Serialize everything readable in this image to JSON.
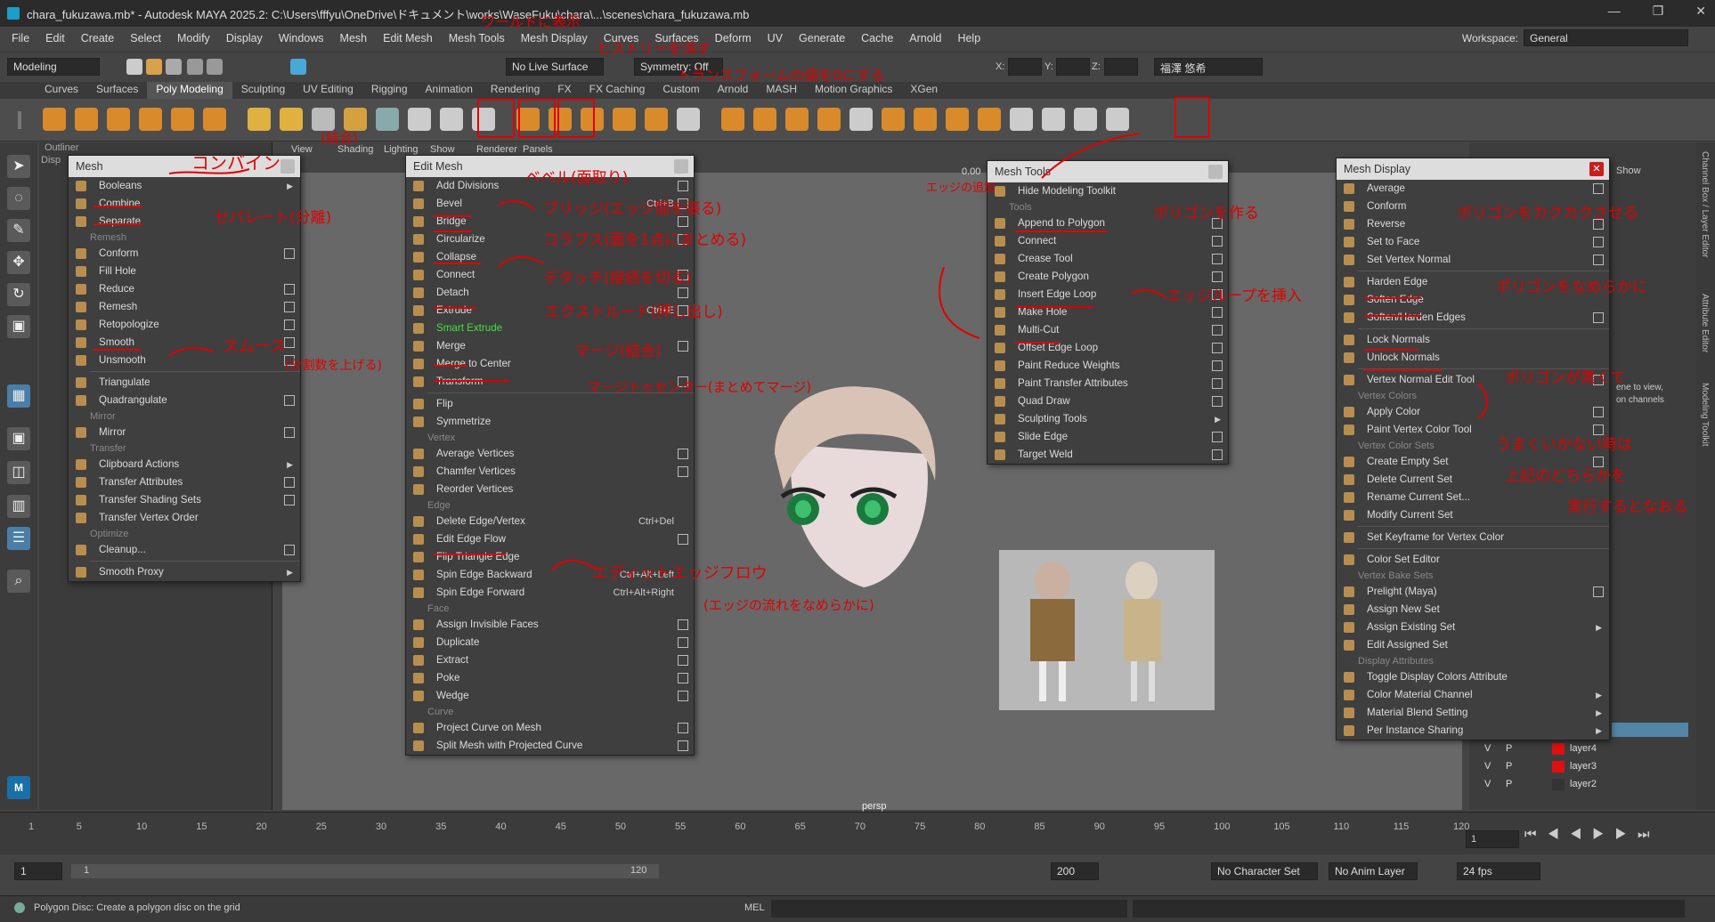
{
  "window": {
    "title": "chara_fukuzawa.mb* - Autodesk MAYA 2025.2: C:\\Users\\fffyu\\OneDrive\\ドキュメント\\works\\WaseFuku\\chara\\...\\scenes\\chara_fukuzawa.mb",
    "controls": [
      "—",
      "❐",
      "✕"
    ]
  },
  "menubar": [
    "File",
    "Edit",
    "Create",
    "Select",
    "Modify",
    "Display",
    "Windows",
    "Mesh",
    "Edit Mesh",
    "Mesh Tools",
    "Mesh Display",
    "Curves",
    "Surfaces",
    "Deform",
    "UV",
    "Generate",
    "Cache",
    "Arnold",
    "Help"
  ],
  "workspace": {
    "label": "Workspace:",
    "value": "General"
  },
  "statusline": {
    "mode": "Modeling",
    "live": "No Live Surface",
    "symmetry": "Symmetry: Off",
    "x": "X:",
    "y": "Y:",
    "z": "Z:",
    "user": "福澤 悠希"
  },
  "shelf_tabs": [
    "Curves",
    "Surfaces",
    "Poly Modeling",
    "Sculpting",
    "UV Editing",
    "Rigging",
    "Animation",
    "Rendering",
    "FX",
    "FX Caching",
    "Custom",
    "Arnold",
    "MASH",
    "Motion Graphics",
    "XGen"
  ],
  "shelf_active": "Poly Modeling",
  "outliner": {
    "title": "Outliner",
    "sub": "Disp"
  },
  "viewport": {
    "menus": [
      "View",
      "Shading",
      "Lighting",
      "Show",
      "Renderer",
      "Panels"
    ],
    "camera": "persp",
    "value": "0.00"
  },
  "menu_mesh": {
    "title": "Mesh",
    "items": [
      {
        "t": "item",
        "label": "Booleans",
        "arrow": true
      },
      {
        "t": "item",
        "label": "Combine"
      },
      {
        "t": "item",
        "label": "Separate"
      },
      {
        "t": "sec",
        "label": "Remesh"
      },
      {
        "t": "item",
        "label": "Conform",
        "opt": true
      },
      {
        "t": "item",
        "label": "Fill Hole"
      },
      {
        "t": "item",
        "label": "Reduce",
        "opt": true
      },
      {
        "t": "item",
        "label": "Remesh",
        "opt": true
      },
      {
        "t": "item",
        "label": "Retopologize",
        "opt": true
      },
      {
        "t": "item",
        "label": "Smooth",
        "opt": true
      },
      {
        "t": "item",
        "label": "Unsmooth",
        "opt": true
      },
      {
        "t": "sep"
      },
      {
        "t": "item",
        "label": "Triangulate"
      },
      {
        "t": "item",
        "label": "Quadrangulate",
        "opt": true
      },
      {
        "t": "sec",
        "label": "Mirror"
      },
      {
        "t": "item",
        "label": "Mirror",
        "opt": true
      },
      {
        "t": "sec",
        "label": "Transfer"
      },
      {
        "t": "item",
        "label": "Clipboard Actions",
        "arrow": true
      },
      {
        "t": "item",
        "label": "Transfer Attributes",
        "opt": true
      },
      {
        "t": "item",
        "label": "Transfer Shading Sets",
        "opt": true
      },
      {
        "t": "item",
        "label": "Transfer Vertex Order"
      },
      {
        "t": "sec",
        "label": "Optimize"
      },
      {
        "t": "item",
        "label": "Cleanup...",
        "opt": true
      },
      {
        "t": "sep"
      },
      {
        "t": "item",
        "label": "Smooth Proxy",
        "arrow": true
      }
    ]
  },
  "menu_editmesh": {
    "title": "Edit Mesh",
    "items": [
      {
        "t": "item",
        "label": "Add Divisions",
        "opt": true
      },
      {
        "t": "item",
        "label": "Bevel",
        "sc": "Ctrl+B",
        "opt": true
      },
      {
        "t": "item",
        "label": "Bridge",
        "opt": true
      },
      {
        "t": "item",
        "label": "Circularize",
        "opt": true
      },
      {
        "t": "item",
        "label": "Collapse"
      },
      {
        "t": "item",
        "label": "Connect",
        "opt": true
      },
      {
        "t": "item",
        "label": "Detach",
        "opt": true
      },
      {
        "t": "item",
        "label": "Extrude",
        "sc": "Ctrl+E",
        "opt": true
      },
      {
        "t": "item",
        "label": "Smart Extrude",
        "green": true
      },
      {
        "t": "item",
        "label": "Merge",
        "opt": true
      },
      {
        "t": "item",
        "label": "Merge to Center"
      },
      {
        "t": "item",
        "label": "Transform",
        "opt": true
      },
      {
        "t": "sep"
      },
      {
        "t": "item",
        "label": "Flip"
      },
      {
        "t": "item",
        "label": "Symmetrize"
      },
      {
        "t": "sec",
        "label": "Vertex"
      },
      {
        "t": "item",
        "label": "Average Vertices",
        "opt": true
      },
      {
        "t": "item",
        "label": "Chamfer Vertices",
        "opt": true
      },
      {
        "t": "item",
        "label": "Reorder Vertices"
      },
      {
        "t": "sec",
        "label": "Edge"
      },
      {
        "t": "item",
        "label": "Delete Edge/Vertex",
        "sc": "Ctrl+Del"
      },
      {
        "t": "item",
        "label": "Edit Edge Flow",
        "opt": true
      },
      {
        "t": "item",
        "label": "Flip Triangle Edge"
      },
      {
        "t": "item",
        "label": "Spin Edge Backward",
        "sc": "Ctrl+Alt+Left"
      },
      {
        "t": "item",
        "label": "Spin Edge Forward",
        "sc": "Ctrl+Alt+Right"
      },
      {
        "t": "sec",
        "label": "Face"
      },
      {
        "t": "item",
        "label": "Assign Invisible Faces",
        "opt": true
      },
      {
        "t": "item",
        "label": "Duplicate",
        "opt": true
      },
      {
        "t": "item",
        "label": "Extract",
        "opt": true
      },
      {
        "t": "item",
        "label": "Poke",
        "opt": true
      },
      {
        "t": "item",
        "label": "Wedge",
        "opt": true
      },
      {
        "t": "sec",
        "label": "Curve"
      },
      {
        "t": "item",
        "label": "Project Curve on Mesh",
        "opt": true
      },
      {
        "t": "item",
        "label": "Split Mesh with Projected Curve",
        "opt": true
      }
    ]
  },
  "menu_meshtools": {
    "title": "Mesh Tools",
    "items": [
      {
        "t": "item",
        "label": "Hide Modeling Toolkit"
      },
      {
        "t": "sec",
        "label": "Tools"
      },
      {
        "t": "item",
        "label": "Append to Polygon",
        "opt": true
      },
      {
        "t": "item",
        "label": "Connect",
        "opt": true
      },
      {
        "t": "item",
        "label": "Crease Tool",
        "opt": true
      },
      {
        "t": "item",
        "label": "Create Polygon",
        "opt": true
      },
      {
        "t": "item",
        "label": "Insert Edge Loop",
        "opt": true
      },
      {
        "t": "item",
        "label": "Make Hole",
        "opt": true
      },
      {
        "t": "item",
        "label": "Multi-Cut",
        "opt": true
      },
      {
        "t": "item",
        "label": "Offset Edge Loop",
        "opt": true
      },
      {
        "t": "item",
        "label": "Paint Reduce Weights",
        "opt": true
      },
      {
        "t": "item",
        "label": "Paint Transfer Attributes",
        "opt": true
      },
      {
        "t": "item",
        "label": "Quad Draw",
        "opt": true
      },
      {
        "t": "item",
        "label": "Sculpting Tools",
        "arrow": true
      },
      {
        "t": "item",
        "label": "Slide Edge",
        "opt": true
      },
      {
        "t": "item",
        "label": "Target Weld",
        "opt": true
      }
    ]
  },
  "menu_meshdisplay": {
    "title": "Mesh Display",
    "items": [
      {
        "t": "item",
        "label": "Average",
        "opt": true
      },
      {
        "t": "item",
        "label": "Conform"
      },
      {
        "t": "item",
        "label": "Reverse",
        "opt": true
      },
      {
        "t": "item",
        "label": "Set to Face",
        "opt": true
      },
      {
        "t": "item",
        "label": "Set Vertex Normal",
        "opt": true
      },
      {
        "t": "sep"
      },
      {
        "t": "item",
        "label": "Harden Edge"
      },
      {
        "t": "item",
        "label": "Soften Edge"
      },
      {
        "t": "item",
        "label": "Soften/Harden Edges",
        "opt": true
      },
      {
        "t": "sep"
      },
      {
        "t": "item",
        "label": "Lock Normals"
      },
      {
        "t": "item",
        "label": "Unlock Normals"
      },
      {
        "t": "sep"
      },
      {
        "t": "item",
        "label": "Vertex Normal Edit Tool",
        "opt": true
      },
      {
        "t": "sec",
        "label": "Vertex Colors"
      },
      {
        "t": "item",
        "label": "Apply Color",
        "opt": true
      },
      {
        "t": "item",
        "label": "Paint Vertex Color Tool",
        "opt": true
      },
      {
        "t": "sec",
        "label": "Vertex Color Sets"
      },
      {
        "t": "item",
        "label": "Create Empty Set",
        "opt": true
      },
      {
        "t": "item",
        "label": "Delete Current Set"
      },
      {
        "t": "item",
        "label": "Rename Current Set..."
      },
      {
        "t": "item",
        "label": "Modify Current Set"
      },
      {
        "t": "sep"
      },
      {
        "t": "item",
        "label": "Set Keyframe for Vertex Color"
      },
      {
        "t": "sep"
      },
      {
        "t": "item",
        "label": "Color Set Editor"
      },
      {
        "t": "sec",
        "label": "Vertex Bake Sets"
      },
      {
        "t": "item",
        "label": "Prelight (Maya)",
        "opt": true
      },
      {
        "t": "item",
        "label": "Assign New Set"
      },
      {
        "t": "item",
        "label": "Assign Existing Set",
        "arrow": true
      },
      {
        "t": "item",
        "label": "Edit Assigned Set"
      },
      {
        "t": "sec",
        "label": "Display Attributes"
      },
      {
        "t": "item",
        "label": "Toggle Display Colors Attribute"
      },
      {
        "t": "item",
        "label": "Color Material Channel",
        "arrow": true
      },
      {
        "t": "item",
        "label": "Material Blend Setting",
        "arrow": true
      },
      {
        "t": "item",
        "label": "Per Instance Sharing",
        "arrow": true
      }
    ]
  },
  "right_panel": {
    "show": "Show",
    "hint1": "ene to view,",
    "hint2": "on channels",
    "tabs": [
      "Channel Box / Layer Editor",
      "Attribute Editor",
      "Modeling Toolkit"
    ],
    "layers": [
      {
        "v": "V",
        "p": "P",
        "name": "layer4",
        "color": "#e01010"
      },
      {
        "v": "V",
        "p": "P",
        "name": "layer3",
        "color": "#e01010"
      },
      {
        "v": "V",
        "p": "P",
        "name": "layer2",
        "color": ""
      }
    ]
  },
  "timeline": {
    "ticks": [
      "1",
      "5",
      "10",
      "15",
      "20",
      "25",
      "30",
      "35",
      "40",
      "45",
      "50",
      "55",
      "60",
      "65",
      "70",
      "75",
      "80",
      "85",
      "90",
      "95",
      "100",
      "105",
      "110",
      "115",
      "120"
    ],
    "current": "1"
  },
  "range": {
    "start": "1",
    "inner_start": "1",
    "inner_end": "120",
    "end": "200",
    "charset": "No Character Set",
    "animlayer": "No Anim Layer",
    "fps": "24 fps"
  },
  "cmdline": {
    "help": "Polygon Disc: Create a polygon disc on the grid",
    "lang": "MEL"
  },
  "annotations": {
    "a_mesh": "コンバイン",
    "a_mesh2": "(結合)",
    "a_sep": "セパレート(分離)",
    "a_smooth": "スムース",
    "a_smooth2": "(分割数を上げる)",
    "a_bevel": "ベベル(面取り)",
    "a_bridge": "ブリッジ(エッジ間を張る)",
    "a_collapse": "コラプス(面を1点にまとめる)",
    "a_detach": "デタッチ(接続を切る)",
    "a_extrude": "エクストルード(押し出し)",
    "a_merge": "マージ(結合)",
    "a_mergec": "マージトゥセンター(まとめてマージ)",
    "a_eef": "エディットエッジフロウ",
    "a_eef2": "(エッジの流れをなめらかに)",
    "a_top1": "ワールドに表示",
    "a_top2": "ヒストリーを消す",
    "a_top3": "トランスフォームの値を0にする",
    "a_edge": "エッジの追加",
    "a_append": "ポリゴンを作る",
    "a_iel": "エッジループを挿入",
    "a_harden": "ポリゴンをカクカクさせる",
    "a_soften": "ポリゴンをなめらかに",
    "a_black1": "ポリゴンが黒くて",
    "a_black2": "うまくいかない時は",
    "a_black3": "上記のどちらかを",
    "a_black4": "実行するとなおる"
  }
}
